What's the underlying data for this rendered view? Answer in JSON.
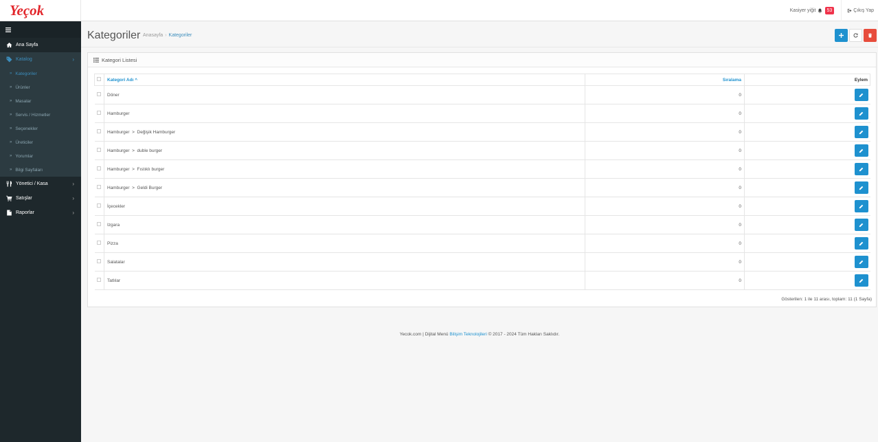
{
  "brand": {
    "logo_text": "Yeçok",
    "colors": {
      "red": "#e2262b",
      "green": "#2e9e3a"
    }
  },
  "header": {
    "user": "Kasiyer yiğit",
    "notif_count": "53",
    "logout": "Çıkış Yap"
  },
  "sidebar": {
    "toggle_icon": "bars-icon",
    "items": [
      {
        "label": "Ana Sayfa",
        "icon": "home-icon"
      },
      {
        "label": "Katalog",
        "icon": "tag-icon"
      },
      {
        "label": "Yönetici / Kasa",
        "icon": "cutlery-icon"
      },
      {
        "label": "Satışlar",
        "icon": "cart-icon"
      },
      {
        "label": "Raporlar",
        "icon": "file-icon"
      }
    ],
    "sub_items": [
      "Kategoriler",
      "Ürünler",
      "Masalar",
      "Servis / Hizmetler",
      "Seçenekler",
      "Üreticiler",
      "Yorumlar",
      "Bilgi Sayfaları"
    ]
  },
  "page": {
    "title": "Kategoriler",
    "breadcrumb": [
      "Anasayfa",
      "Kategoriler"
    ],
    "add_icon": "plus-icon",
    "refresh_icon": "refresh-icon",
    "delete_icon": "trash-icon"
  },
  "panel": {
    "title": "Kategori Listesi"
  },
  "table": {
    "headers": {
      "name": "Kategori Adı",
      "sort": "Sıralama",
      "action": "Eylem"
    },
    "rows": [
      {
        "name": "Döner",
        "sort": "0"
      },
      {
        "name": "Hamburger",
        "sort": "0"
      },
      {
        "name": "Hamburger  >  Değişik Hamburger",
        "sort": "0"
      },
      {
        "name": "Hamburger  >  duble burger",
        "sort": "0"
      },
      {
        "name": "Hamburger  >  Fıstıklı burger",
        "sort": "0"
      },
      {
        "name": "Hamburger  >  Geldi Burger",
        "sort": "0"
      },
      {
        "name": "İçecekler",
        "sort": "0"
      },
      {
        "name": "Izgara",
        "sort": "0"
      },
      {
        "name": "Pizza",
        "sort": "0"
      },
      {
        "name": "Salatalar",
        "sort": "0"
      },
      {
        "name": "Tatlılar",
        "sort": "0"
      }
    ]
  },
  "paging": "Gösterilen: 1 ile 11 arası, toplam: 11 (1 Sayfa)",
  "footer": {
    "pre": "Yecok.com | Dijital Menü ",
    "link": "Bilişim Teknolojileri",
    "post": " © 2017 - 2024 Tüm Hakları Saklıdır."
  }
}
